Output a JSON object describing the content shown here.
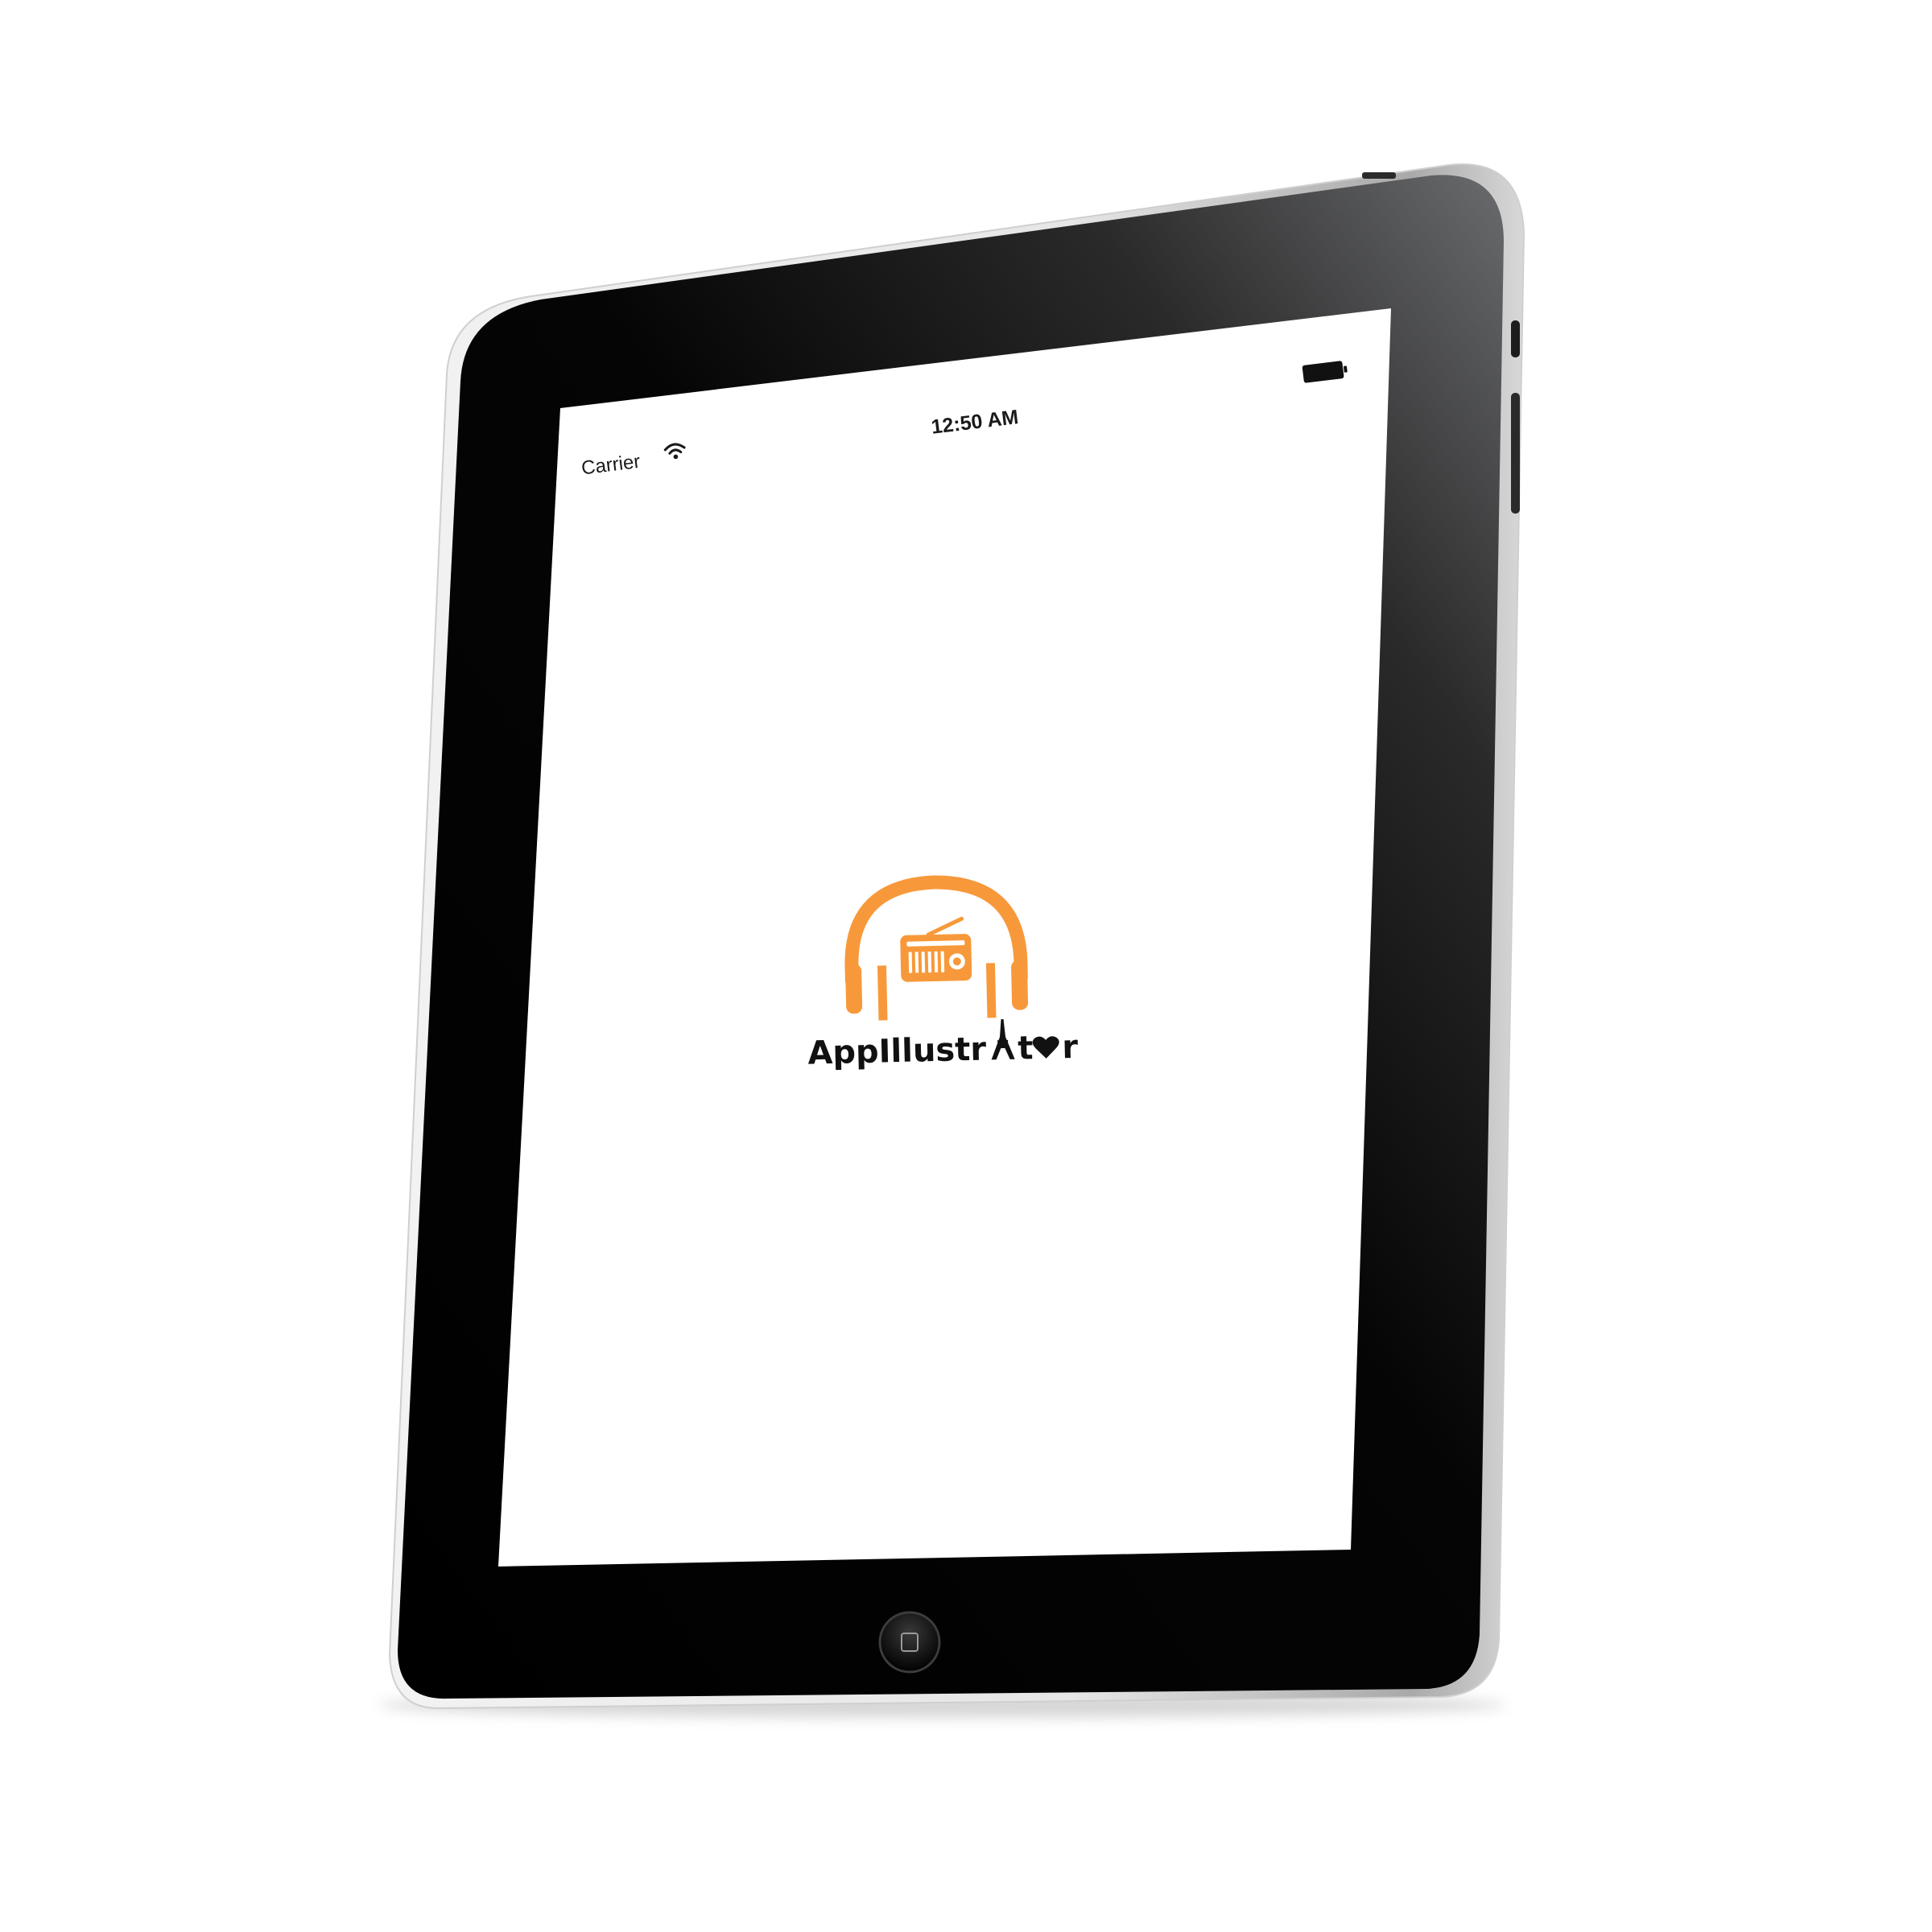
{
  "status_bar": {
    "carrier": "Carrier",
    "time": "12:50 AM"
  },
  "splash": {
    "brand_left": "AppIllustr",
    "brand_right": "t",
    "brand_end": "r"
  },
  "icons": {
    "wifi": "wifi-icon",
    "battery": "battery-icon",
    "logo": "headphones-radio-logo",
    "home": "home-button-icon"
  },
  "colors": {
    "accent": "#F7993A",
    "bezel": "#050505",
    "screen": "#FFFFFF"
  }
}
